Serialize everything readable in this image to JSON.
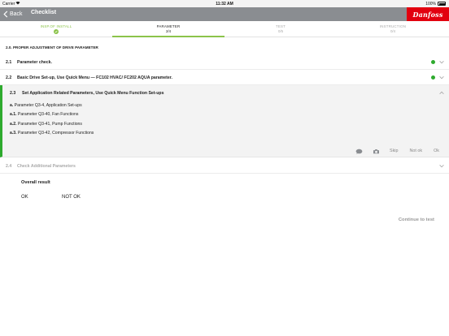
{
  "status_bar": {
    "carrier": "Carrier",
    "time": "11:32 AM",
    "battery": "100%"
  },
  "nav": {
    "back_label": "Back",
    "title": "Checklist",
    "logo_text": "Danfoss",
    "brand_color": "#e2000f"
  },
  "steps": [
    {
      "name": "INSP.OF INSTALL",
      "count": "",
      "state": "done"
    },
    {
      "name": "PARAMETER",
      "count": "2/4",
      "state": "active"
    },
    {
      "name": "TEST",
      "count": "0/5",
      "state": "inactive"
    },
    {
      "name": "INSTRUCTION",
      "count": "0/4",
      "state": "inactive"
    }
  ],
  "section_title": "2.0. PROPER ADJUSTMENT OF DRIVE PARAMETER",
  "items": [
    {
      "num": "2.1",
      "label": "Parameter check.",
      "status": "green"
    },
    {
      "num": "2.2",
      "label": "Basic Drive Set-up, Use Quick Menu — FC102 HVAC/ FC202 AQUA parameter.",
      "status": "green"
    }
  ],
  "expanded_item": {
    "num": "2.3",
    "label": "Set Application Related Parameters, Use Quick Menu Function Set-ups",
    "sub_items": [
      {
        "prefix": "a.",
        "text": "Parameter Q3-4, Application Set-ups"
      },
      {
        "prefix": "a.1.",
        "text": "Parameter Q3-40, Fan Functions"
      },
      {
        "prefix": "a.2.",
        "text": "Parameter Q3-41, Pump Functions"
      },
      {
        "prefix": "a.3.",
        "text": "Parameter Q3-42, Compressor Functions"
      }
    ],
    "actions": {
      "comment_icon": "comment-icon",
      "camera_icon": "camera-icon",
      "skip": "Skip",
      "not_ok": "Not ok",
      "ok": "Ok"
    }
  },
  "disabled_item": {
    "num": "2.4",
    "label": "Check Additional Parameters"
  },
  "overall": {
    "title": "Overall result",
    "ok": "OK",
    "not_ok": "NOT OK"
  },
  "continue_label": "Continue to test"
}
